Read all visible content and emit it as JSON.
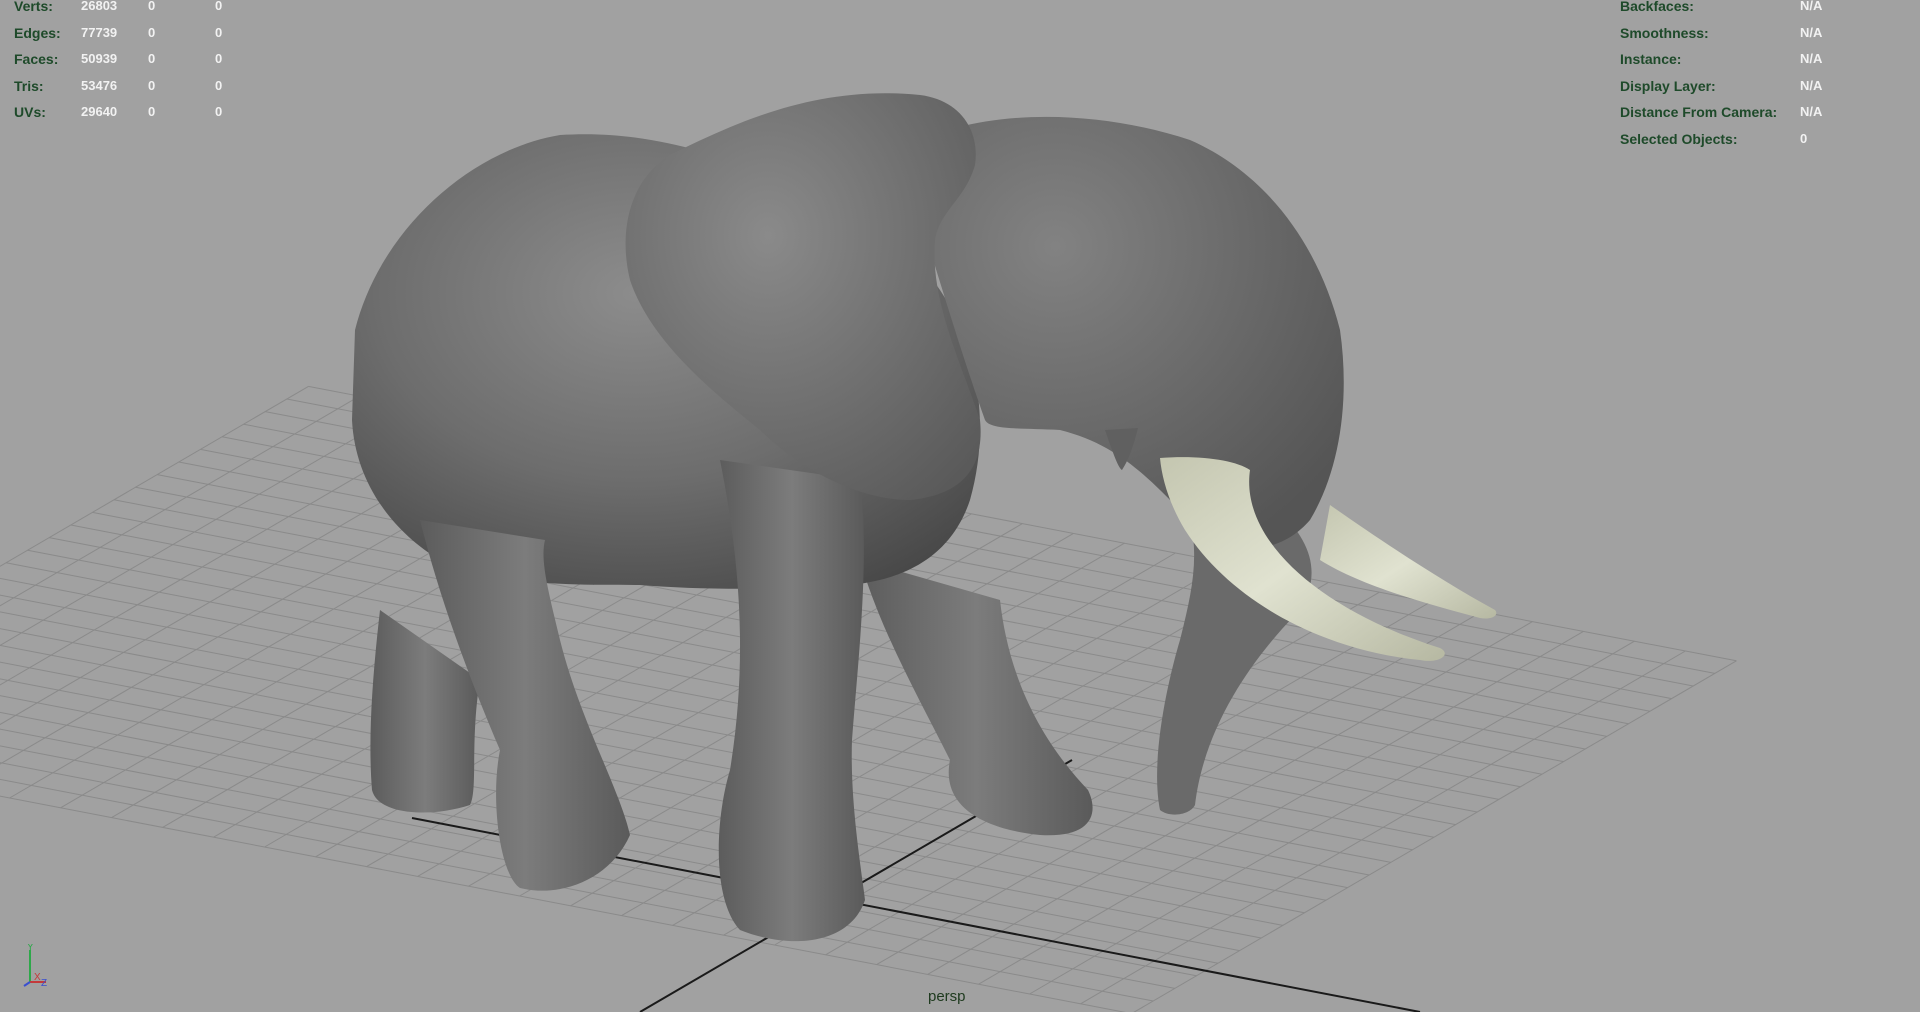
{
  "viewport": {
    "camera": "persp",
    "background_color": "#a1a1a1",
    "hud_label_color": "#1e4a2a",
    "hud_value_color": "#f2f2f2"
  },
  "poly_count": [
    {
      "label": "Verts:",
      "total": "26803",
      "selected": "0",
      "component": "0"
    },
    {
      "label": "Edges:",
      "total": "77739",
      "selected": "0",
      "component": "0"
    },
    {
      "label": "Faces:",
      "total": "50939",
      "selected": "0",
      "component": "0"
    },
    {
      "label": "Tris:",
      "total": "53476",
      "selected": "0",
      "component": "0"
    },
    {
      "label": "UVs:",
      "total": "29640",
      "selected": "0",
      "component": "0"
    }
  ],
  "object_details": [
    {
      "label": "Backfaces:",
      "value": "N/A"
    },
    {
      "label": "Smoothness:",
      "value": "N/A"
    },
    {
      "label": "Instance:",
      "value": "N/A"
    },
    {
      "label": "Display Layer:",
      "value": "N/A"
    },
    {
      "label": "Distance From Camera:",
      "value": "N/A"
    },
    {
      "label": "Selected Objects:",
      "value": "0"
    }
  ],
  "axis_gizmo": {
    "y": "Y",
    "x": "X",
    "z": "Z"
  },
  "model": {
    "name_icon": "elephant-model",
    "body_color": "#6e6e6e",
    "tusk_color": "#d2d4c0"
  }
}
